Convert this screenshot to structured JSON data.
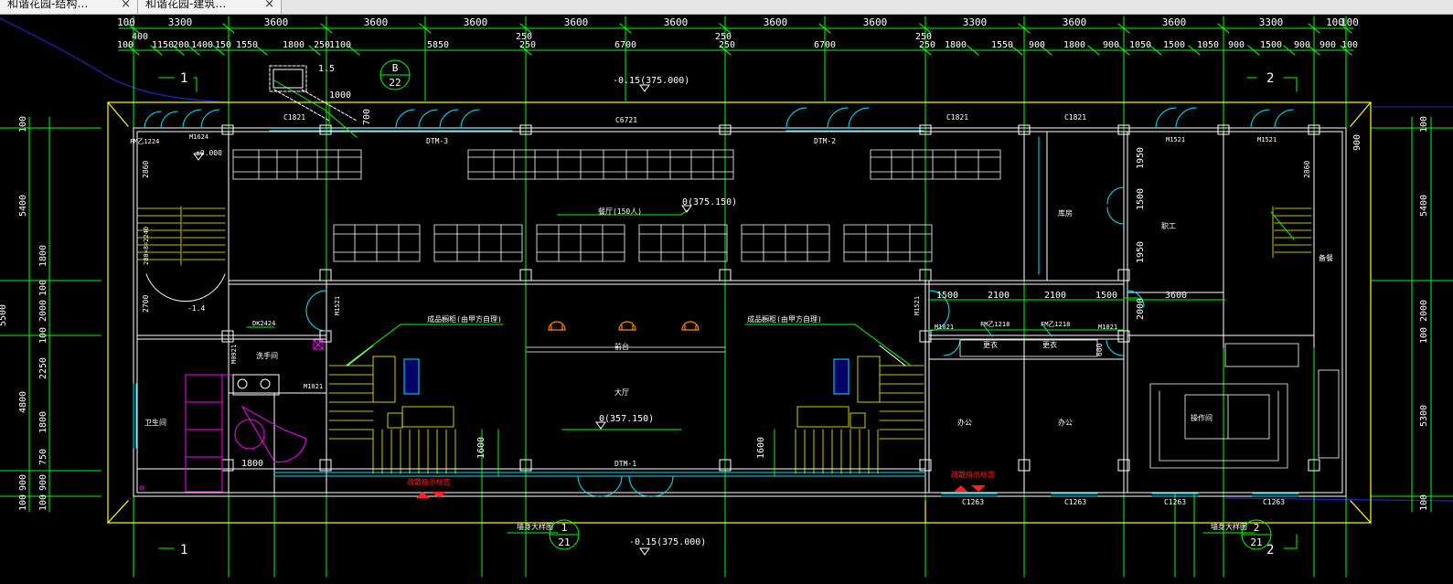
{
  "tabs": [
    {
      "label": "和谐花园-结构…",
      "close": "×"
    },
    {
      "label": "和谐花园-建筑…",
      "close": "×"
    }
  ],
  "dims_top_row1": [
    "100",
    "3300",
    "3600",
    "3600",
    "3600",
    "3600",
    "3600",
    "3600",
    "3600",
    "3300",
    "100"
  ],
  "dims_top_row2": [
    "100",
    "400",
    "1150",
    "200",
    "1400",
    "150",
    "1550",
    "1800",
    "250",
    "1100",
    "5850",
    "250",
    "6700",
    "250",
    "6700",
    "250",
    "1800",
    "1550",
    "900",
    "1800",
    "900",
    "1050",
    "1500",
    "1050",
    "900",
    "1500",
    "900",
    "900",
    "100"
  ],
  "top_250_marks": [
    "250",
    "250",
    "250"
  ],
  "axis_labels": {
    "left_top": "1",
    "right_top": "2",
    "left_bottom": "1",
    "right_bottom": "2"
  },
  "elevations": {
    "top": "-0.15(375.000)",
    "bottom": "-0.15(375.000)",
    "dining": "0(375.150)",
    "hall": "0(357.150)",
    "stair_zero": "±0.000"
  },
  "left_dims": [
    "100",
    "5400",
    "100",
    "1800",
    "2000",
    "100",
    "2250",
    "4800",
    "1800",
    "750",
    "900",
    "100",
    "5500",
    "900",
    "100"
  ],
  "right_dims": [
    "100",
    "5400",
    "2000",
    "100",
    "5300",
    "100"
  ],
  "section_marks": [
    {
      "num": "B",
      "sheet": "22"
    },
    {
      "num": "1",
      "sheet": "21"
    },
    {
      "num": "2",
      "sheet": "21"
    }
  ],
  "window_labels": [
    "C1821",
    "C6721",
    "C1821",
    "C1821",
    "C1263",
    "C1263",
    "C1263",
    "C1263"
  ],
  "door_labels": [
    "M1624",
    "M1521",
    "M1521",
    "M1521",
    "M1521",
    "FM乙1224",
    "DK2424",
    "M1021",
    "M1021",
    "M0921",
    "FM乙1218",
    "FM乙1218",
    "M1021"
  ],
  "beam_labels": [
    "DTM-3",
    "DTM-2",
    "DTM-1"
  ],
  "room_labels": {
    "dining": "餐厅(150人)",
    "showcase_left": "成品橱柜(由甲方自理)",
    "showcase_right": "成品橱柜(由甲方自理)",
    "hall": "大厅",
    "reception": "前台",
    "toilet": "卫生间",
    "washroom": "洗手间",
    "office1": "办公",
    "office2": "办公",
    "kitchen": "操作间",
    "storage": "库房",
    "changing": "更衣",
    "changing2": "更衣",
    "staff": "职工",
    "prep": "备餐"
  },
  "red_labels": [
    "疏散指示标志",
    "疏散指示标志"
  ],
  "detail_labels": [
    "墙身大样图",
    "墙身大样图"
  ],
  "misc_dims": {
    "d1600a": "1600",
    "d1600b": "1600",
    "d1000": "1000",
    "d1_5": "1.5",
    "d700": "700",
    "d900r": "900",
    "d1800": "1800",
    "d1500a": "1500",
    "d2100a": "2100",
    "d2100b": "2100",
    "d1500b": "1500",
    "d3600": "3600",
    "d1950a": "1950",
    "d1500v": "1500",
    "d1950b": "1950",
    "d2860": "2860",
    "d2860r": "2860",
    "d2700": "2700",
    "d2000v": "2000",
    "d600": "600",
    "d1_4": "-1.4",
    "stair_note": "280×8=2240"
  },
  "colors": {
    "grid": "#00ff00",
    "wall": "#ffffff",
    "outline": "#ffff00",
    "door": "#00e5ff",
    "axis_blue": "#2222cc",
    "magenta": "#ff00ff",
    "orange": "#ff8800",
    "red": "#ff2020"
  }
}
